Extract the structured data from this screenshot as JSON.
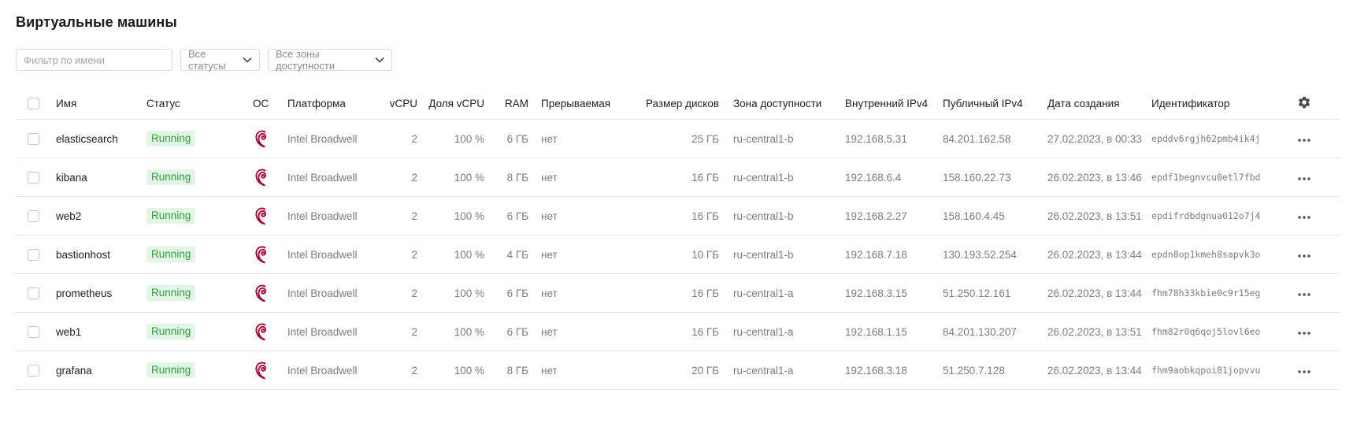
{
  "page": {
    "title": "Виртуальные машины"
  },
  "filters": {
    "name_placeholder": "Фильтр по имени",
    "status_select": "Все статусы",
    "zone_select": "Все зоны доступности"
  },
  "table": {
    "headers": {
      "name": "Имя",
      "status": "Статус",
      "os": "ОС",
      "platform": "Платформа",
      "vcpu": "vCPU",
      "vcpu_share": "Доля vCPU",
      "ram": "RAM",
      "preemptible": "Прерываемая",
      "disk_size": "Размер дисков",
      "zone": "Зона доступности",
      "internal_ip": "Внутренний IPv4",
      "public_ip": "Публичный IPv4",
      "created": "Дата создания",
      "id": "Идентификатор"
    },
    "settings_icon": "gear-icon",
    "row_actions_icon": "more-horizontal-icon",
    "os_icon": "debian-logo-icon",
    "colors": {
      "status_bg": "#e3f5e4",
      "status_text": "#2e9e3b",
      "os_icon": "#a80030"
    },
    "rows": [
      {
        "name": "elasticsearch",
        "status": "Running",
        "platform": "Intel Broadwell",
        "vcpu": "2",
        "vcpu_share": "100 %",
        "ram": "6 ГБ",
        "preemptible": "нет",
        "disk_size": "25 ГБ",
        "zone": "ru-central1-b",
        "internal_ip": "192.168.5.31",
        "public_ip": "84.201.162.58",
        "created": "27.02.2023, в 00:33",
        "id": "epddv6rgjh62pmb4ik4j"
      },
      {
        "name": "kibana",
        "status": "Running",
        "platform": "Intel Broadwell",
        "vcpu": "2",
        "vcpu_share": "100 %",
        "ram": "8 ГБ",
        "preemptible": "нет",
        "disk_size": "16 ГБ",
        "zone": "ru-central1-b",
        "internal_ip": "192.168.6.4",
        "public_ip": "158.160.22.73",
        "created": "26.02.2023, в 13:46",
        "id": "epdf1begnvcu0etl7fbd"
      },
      {
        "name": "web2",
        "status": "Running",
        "platform": "Intel Broadwell",
        "vcpu": "2",
        "vcpu_share": "100 %",
        "ram": "6 ГБ",
        "preemptible": "нет",
        "disk_size": "16 ГБ",
        "zone": "ru-central1-b",
        "internal_ip": "192.168.2.27",
        "public_ip": "158.160.4.45",
        "created": "26.02.2023, в 13:51",
        "id": "epdifrdbdgnua012o7j4"
      },
      {
        "name": "bastionhost",
        "status": "Running",
        "platform": "Intel Broadwell",
        "vcpu": "2",
        "vcpu_share": "100 %",
        "ram": "4 ГБ",
        "preemptible": "нет",
        "disk_size": "10 ГБ",
        "zone": "ru-central1-b",
        "internal_ip": "192.168.7.18",
        "public_ip": "130.193.52.254",
        "created": "26.02.2023, в 13:44",
        "id": "epdn8op1kmeh8sapvk3o"
      },
      {
        "name": "prometheus",
        "status": "Running",
        "platform": "Intel Broadwell",
        "vcpu": "2",
        "vcpu_share": "100 %",
        "ram": "6 ГБ",
        "preemptible": "нет",
        "disk_size": "16 ГБ",
        "zone": "ru-central1-a",
        "internal_ip": "192.168.3.15",
        "public_ip": "51.250.12.161",
        "created": "26.02.2023, в 13:44",
        "id": "fhm78h33kbie0c9r15eg"
      },
      {
        "name": "web1",
        "status": "Running",
        "platform": "Intel Broadwell",
        "vcpu": "2",
        "vcpu_share": "100 %",
        "ram": "6 ГБ",
        "preemptible": "нет",
        "disk_size": "16 ГБ",
        "zone": "ru-central1-a",
        "internal_ip": "192.168.1.15",
        "public_ip": "84.201.130.207",
        "created": "26.02.2023, в 13:51",
        "id": "fhm82r0q6qoj5lovl6eo"
      },
      {
        "name": "grafana",
        "status": "Running",
        "platform": "Intel Broadwell",
        "vcpu": "2",
        "vcpu_share": "100 %",
        "ram": "8 ГБ",
        "preemptible": "нет",
        "disk_size": "20 ГБ",
        "zone": "ru-central1-a",
        "internal_ip": "192.168.3.18",
        "public_ip": "51.250.7.128",
        "created": "26.02.2023, в 13:44",
        "id": "fhm9aobkqpoi81jopvvu"
      }
    ]
  }
}
